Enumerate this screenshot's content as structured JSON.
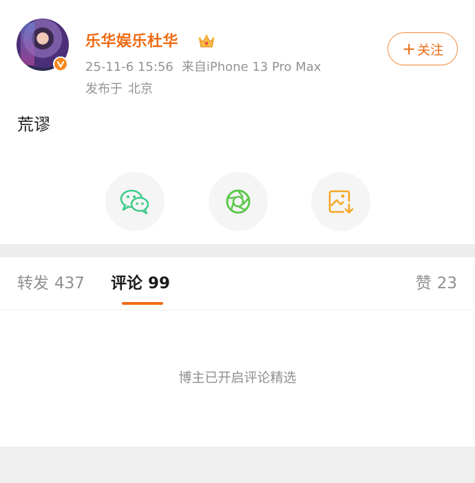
{
  "post": {
    "username": "乐华娱乐杜华",
    "timestamp": "25-11-6 15:56",
    "source": "来自iPhone 13 Pro Max",
    "location_prefix": "发布于",
    "location": "北京",
    "follow_label": "关注",
    "follow_plus": "+",
    "text": "荒谬",
    "badge_icon": "verified-v-icon",
    "crown_icon": "crown-icon"
  },
  "share": {
    "wechat_icon": "wechat-icon",
    "moments_icon": "moments-icon",
    "save_icon": "save-image-icon"
  },
  "tabs": {
    "forward_label": "转发",
    "forward_count": "437",
    "comments_label": "评论",
    "comments_count": "99",
    "likes_label": "赞",
    "likes_count": "23"
  },
  "comments": {
    "notice": "博主已开启评论精选"
  },
  "colors": {
    "accent": "#ef6a13",
    "wechat_green": "#3ecb8a",
    "moments_green": "#5cc84b",
    "save_orange": "#f5a623"
  }
}
